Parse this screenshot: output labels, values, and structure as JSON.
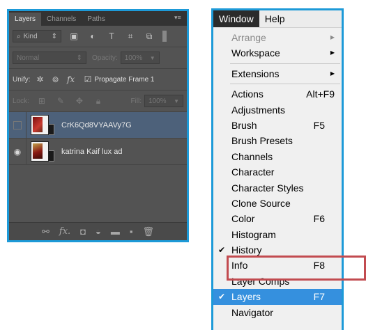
{
  "layers_panel": {
    "tabs": [
      "Layers",
      "Channels",
      "Paths"
    ],
    "filter_kind": "Kind",
    "blend_mode": "Normal",
    "opacity_label": "Opacity:",
    "opacity_value": "100%",
    "unify_label": "Unify:",
    "propagate_label": "Propagate Frame 1",
    "lock_label": "Lock:",
    "fill_label": "Fill:",
    "fill_value": "100%",
    "layers": [
      {
        "name": "CrK6Qd8VYAAVy7G",
        "visible": false,
        "selected": true
      },
      {
        "name": "katrina Kaif lux ad",
        "visible": true,
        "selected": false
      }
    ]
  },
  "menubar": {
    "window": "Window",
    "help": "Help"
  },
  "window_menu": {
    "arrange": "Arrange",
    "workspace": "Workspace",
    "extensions": "Extensions",
    "actions": {
      "label": "Actions",
      "shortcut": "Alt+F9"
    },
    "adjustments": "Adjustments",
    "brush": {
      "label": "Brush",
      "shortcut": "F5"
    },
    "brush_presets": "Brush Presets",
    "channels": "Channels",
    "character": "Character",
    "character_styles": "Character Styles",
    "clone_source": "Clone Source",
    "color": {
      "label": "Color",
      "shortcut": "F6"
    },
    "histogram": "Histogram",
    "history": "History",
    "info": {
      "label": "Info",
      "shortcut": "F8"
    },
    "layer_comps": "Layer Comps",
    "layers": {
      "label": "Layers",
      "shortcut": "F7"
    },
    "navigator": "Navigator"
  },
  "colors": {
    "accent": "#1d9ad8",
    "highlight": "#c24b50",
    "selection": "#3590de",
    "panel_bg": "#535353"
  }
}
